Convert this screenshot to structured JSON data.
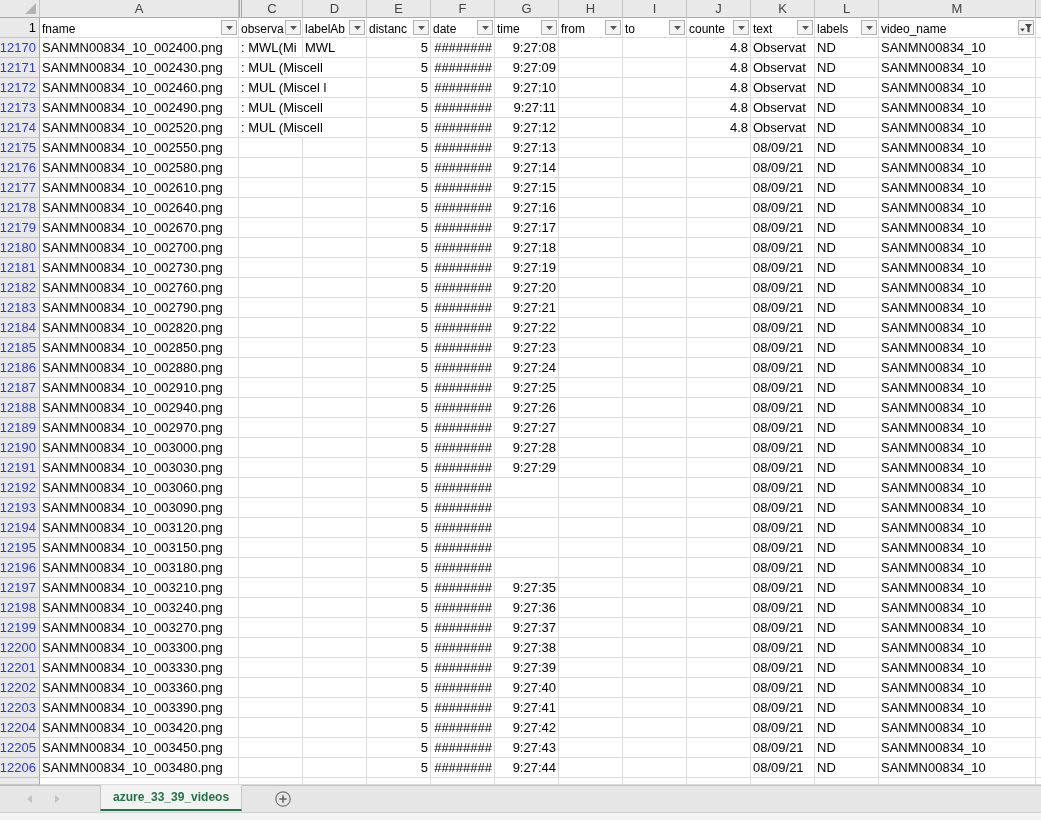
{
  "sheet": {
    "columns": [
      {
        "letter": "A",
        "title": "fname",
        "kind": "text",
        "filtered": false,
        "hidden_column_before": false
      },
      {
        "letter": "C",
        "title": "observa",
        "kind": "text",
        "filtered": false,
        "hidden_column_before": true
      },
      {
        "letter": "D",
        "title": "labelAb",
        "kind": "text",
        "filtered": false,
        "hidden_column_before": false
      },
      {
        "letter": "E",
        "title": "distanc",
        "kind": "number",
        "filtered": false,
        "hidden_column_before": false
      },
      {
        "letter": "F",
        "title": "date",
        "kind": "number",
        "filtered": false,
        "hidden_column_before": false
      },
      {
        "letter": "G",
        "title": "time",
        "kind": "number",
        "filtered": false,
        "hidden_column_before": false
      },
      {
        "letter": "H",
        "title": "from",
        "kind": "text",
        "filtered": false,
        "hidden_column_before": false
      },
      {
        "letter": "I",
        "title": "to",
        "kind": "text",
        "filtered": false,
        "hidden_column_before": false
      },
      {
        "letter": "J",
        "title": "counte",
        "kind": "number",
        "filtered": false,
        "hidden_column_before": false
      },
      {
        "letter": "K",
        "title": "text",
        "kind": "text",
        "filtered": false,
        "hidden_column_before": false
      },
      {
        "letter": "L",
        "title": "labels",
        "kind": "text",
        "filtered": false,
        "hidden_column_before": false
      },
      {
        "letter": "M",
        "title": "video_name",
        "kind": "text",
        "filtered": true,
        "hidden_column_before": false
      }
    ],
    "header_row_number": "1",
    "rows": [
      {
        "number": "12170",
        "filtered": true,
        "cells": [
          "SANMN00834_10_002400.png",
          ": MWL(Mi",
          "MWL",
          "5",
          "########",
          "9:27:08",
          null,
          null,
          "4.8",
          "Observat",
          "ND",
          "SANMN00834_10"
        ]
      },
      {
        "number": "12171",
        "filtered": true,
        "cells": [
          "SANMN00834_10_002430.png",
          ": MUL (Miscell",
          null,
          "5",
          "########",
          "9:27:09",
          null,
          null,
          "4.8",
          "Observat",
          "ND",
          "SANMN00834_10"
        ]
      },
      {
        "number": "12172",
        "filtered": true,
        "cells": [
          "SANMN00834_10_002460.png",
          ": MUL (Miscel l",
          null,
          "5",
          "########",
          "9:27:10",
          null,
          null,
          "4.8",
          "Observat",
          "ND",
          "SANMN00834_10"
        ]
      },
      {
        "number": "12173",
        "filtered": true,
        "cells": [
          "SANMN00834_10_002490.png",
          ": MUL (Miscell",
          null,
          "5",
          "########",
          "9:27:11",
          null,
          null,
          "4.8",
          "Observat",
          "ND",
          "SANMN00834_10"
        ]
      },
      {
        "number": "12174",
        "filtered": true,
        "cells": [
          "SANMN00834_10_002520.png",
          ": MUL (Miscell",
          null,
          "5",
          "########",
          "9:27:12",
          null,
          null,
          "4.8",
          "Observat",
          "ND",
          "SANMN00834_10"
        ]
      },
      {
        "number": "12175",
        "filtered": true,
        "cells": [
          "SANMN00834_10_002550.png",
          null,
          null,
          "5",
          "########",
          "9:27:13",
          null,
          null,
          null,
          "08/09/21",
          "ND",
          "SANMN00834_10"
        ]
      },
      {
        "number": "12176",
        "filtered": true,
        "cells": [
          "SANMN00834_10_002580.png",
          null,
          null,
          "5",
          "########",
          "9:27:14",
          null,
          null,
          null,
          "08/09/21",
          "ND",
          "SANMN00834_10"
        ]
      },
      {
        "number": "12177",
        "filtered": true,
        "cells": [
          "SANMN00834_10_002610.png",
          null,
          null,
          "5",
          "########",
          "9:27:15",
          null,
          null,
          null,
          "08/09/21",
          "ND",
          "SANMN00834_10"
        ]
      },
      {
        "number": "12178",
        "filtered": true,
        "cells": [
          "SANMN00834_10_002640.png",
          null,
          null,
          "5",
          "########",
          "9:27:16",
          null,
          null,
          null,
          "08/09/21",
          "ND",
          "SANMN00834_10"
        ]
      },
      {
        "number": "12179",
        "filtered": true,
        "cells": [
          "SANMN00834_10_002670.png",
          null,
          null,
          "5",
          "########",
          "9:27:17",
          null,
          null,
          null,
          "08/09/21",
          "ND",
          "SANMN00834_10"
        ]
      },
      {
        "number": "12180",
        "filtered": true,
        "cells": [
          "SANMN00834_10_002700.png",
          null,
          null,
          "5",
          "########",
          "9:27:18",
          null,
          null,
          null,
          "08/09/21",
          "ND",
          "SANMN00834_10"
        ]
      },
      {
        "number": "12181",
        "filtered": true,
        "cells": [
          "SANMN00834_10_002730.png",
          null,
          null,
          "5",
          "########",
          "9:27:19",
          null,
          null,
          null,
          "08/09/21",
          "ND",
          "SANMN00834_10"
        ]
      },
      {
        "number": "12182",
        "filtered": true,
        "cells": [
          "SANMN00834_10_002760.png",
          null,
          null,
          "5",
          "########",
          "9:27:20",
          null,
          null,
          null,
          "08/09/21",
          "ND",
          "SANMN00834_10"
        ]
      },
      {
        "number": "12183",
        "filtered": true,
        "cells": [
          "SANMN00834_10_002790.png",
          null,
          null,
          "5",
          "########",
          "9:27:21",
          null,
          null,
          null,
          "08/09/21",
          "ND",
          "SANMN00834_10"
        ]
      },
      {
        "number": "12184",
        "filtered": true,
        "cells": [
          "SANMN00834_10_002820.png",
          null,
          null,
          "5",
          "########",
          "9:27:22",
          null,
          null,
          null,
          "08/09/21",
          "ND",
          "SANMN00834_10"
        ]
      },
      {
        "number": "12185",
        "filtered": true,
        "cells": [
          "SANMN00834_10_002850.png",
          null,
          null,
          "5",
          "########",
          "9:27:23",
          null,
          null,
          null,
          "08/09/21",
          "ND",
          "SANMN00834_10"
        ]
      },
      {
        "number": "12186",
        "filtered": true,
        "cells": [
          "SANMN00834_10_002880.png",
          null,
          null,
          "5",
          "########",
          "9:27:24",
          null,
          null,
          null,
          "08/09/21",
          "ND",
          "SANMN00834_10"
        ]
      },
      {
        "number": "12187",
        "filtered": true,
        "cells": [
          "SANMN00834_10_002910.png",
          null,
          null,
          "5",
          "########",
          "9:27:25",
          null,
          null,
          null,
          "08/09/21",
          "ND",
          "SANMN00834_10"
        ]
      },
      {
        "number": "12188",
        "filtered": true,
        "cells": [
          "SANMN00834_10_002940.png",
          null,
          null,
          "5",
          "########",
          "9:27:26",
          null,
          null,
          null,
          "08/09/21",
          "ND",
          "SANMN00834_10"
        ]
      },
      {
        "number": "12189",
        "filtered": true,
        "cells": [
          "SANMN00834_10_002970.png",
          null,
          null,
          "5",
          "########",
          "9:27:27",
          null,
          null,
          null,
          "08/09/21",
          "ND",
          "SANMN00834_10"
        ]
      },
      {
        "number": "12190",
        "filtered": true,
        "cells": [
          "SANMN00834_10_003000.png",
          null,
          null,
          "5",
          "########",
          "9:27:28",
          null,
          null,
          null,
          "08/09/21",
          "ND",
          "SANMN00834_10"
        ]
      },
      {
        "number": "12191",
        "filtered": true,
        "cells": [
          "SANMN00834_10_003030.png",
          null,
          null,
          "5",
          "########",
          "9:27:29",
          null,
          null,
          null,
          "08/09/21",
          "ND",
          "SANMN00834_10"
        ]
      },
      {
        "number": "12192",
        "filtered": true,
        "cells": [
          "SANMN00834_10_003060.png",
          null,
          null,
          "5",
          "########",
          null,
          null,
          null,
          null,
          "08/09/21",
          "ND",
          "SANMN00834_10"
        ]
      },
      {
        "number": "12193",
        "filtered": true,
        "cells": [
          "SANMN00834_10_003090.png",
          null,
          null,
          "5",
          "########",
          null,
          null,
          null,
          null,
          "08/09/21",
          "ND",
          "SANMN00834_10"
        ]
      },
      {
        "number": "12194",
        "filtered": true,
        "cells": [
          "SANMN00834_10_003120.png",
          null,
          null,
          "5",
          "########",
          null,
          null,
          null,
          null,
          "08/09/21",
          "ND",
          "SANMN00834_10"
        ]
      },
      {
        "number": "12195",
        "filtered": true,
        "cells": [
          "SANMN00834_10_003150.png",
          null,
          null,
          "5",
          "########",
          null,
          null,
          null,
          null,
          "08/09/21",
          "ND",
          "SANMN00834_10"
        ]
      },
      {
        "number": "12196",
        "filtered": true,
        "cells": [
          "SANMN00834_10_003180.png",
          null,
          null,
          "5",
          "########",
          null,
          null,
          null,
          null,
          "08/09/21",
          "ND",
          "SANMN00834_10"
        ]
      },
      {
        "number": "12197",
        "filtered": true,
        "cells": [
          "SANMN00834_10_003210.png",
          null,
          null,
          "5",
          "########",
          "9:27:35",
          null,
          null,
          null,
          "08/09/21",
          "ND",
          "SANMN00834_10"
        ]
      },
      {
        "number": "12198",
        "filtered": true,
        "cells": [
          "SANMN00834_10_003240.png",
          null,
          null,
          "5",
          "########",
          "9:27:36",
          null,
          null,
          null,
          "08/09/21",
          "ND",
          "SANMN00834_10"
        ]
      },
      {
        "number": "12199",
        "filtered": true,
        "cells": [
          "SANMN00834_10_003270.png",
          null,
          null,
          "5",
          "########",
          "9:27:37",
          null,
          null,
          null,
          "08/09/21",
          "ND",
          "SANMN00834_10"
        ]
      },
      {
        "number": "12200",
        "filtered": true,
        "cells": [
          "SANMN00834_10_003300.png",
          null,
          null,
          "5",
          "########",
          "9:27:38",
          null,
          null,
          null,
          "08/09/21",
          "ND",
          "SANMN00834_10"
        ]
      },
      {
        "number": "12201",
        "filtered": true,
        "cells": [
          "SANMN00834_10_003330.png",
          null,
          null,
          "5",
          "########",
          "9:27:39",
          null,
          null,
          null,
          "08/09/21",
          "ND",
          "SANMN00834_10"
        ]
      },
      {
        "number": "12202",
        "filtered": true,
        "cells": [
          "SANMN00834_10_003360.png",
          null,
          null,
          "5",
          "########",
          "9:27:40",
          null,
          null,
          null,
          "08/09/21",
          "ND",
          "SANMN00834_10"
        ]
      },
      {
        "number": "12203",
        "filtered": true,
        "cells": [
          "SANMN00834_10_003390.png",
          null,
          null,
          "5",
          "########",
          "9:27:41",
          null,
          null,
          null,
          "08/09/21",
          "ND",
          "SANMN00834_10"
        ]
      },
      {
        "number": "12204",
        "filtered": true,
        "cells": [
          "SANMN00834_10_003420.png",
          null,
          null,
          "5",
          "########",
          "9:27:42",
          null,
          null,
          null,
          "08/09/21",
          "ND",
          "SANMN00834_10"
        ]
      },
      {
        "number": "12205",
        "filtered": true,
        "cells": [
          "SANMN00834_10_003450.png",
          null,
          null,
          "5",
          "########",
          "9:27:43",
          null,
          null,
          null,
          "08/09/21",
          "ND",
          "SANMN00834_10"
        ]
      },
      {
        "number": "12206",
        "filtered": true,
        "cells": [
          "SANMN00834_10_003480.png",
          null,
          null,
          "5",
          "########",
          "9:27:44",
          null,
          null,
          null,
          "08/09/21",
          "ND",
          "SANMN00834_10"
        ]
      }
    ]
  },
  "sheet_tabs": [
    {
      "label": "azure_33_39_videos",
      "selected": true
    }
  ]
}
